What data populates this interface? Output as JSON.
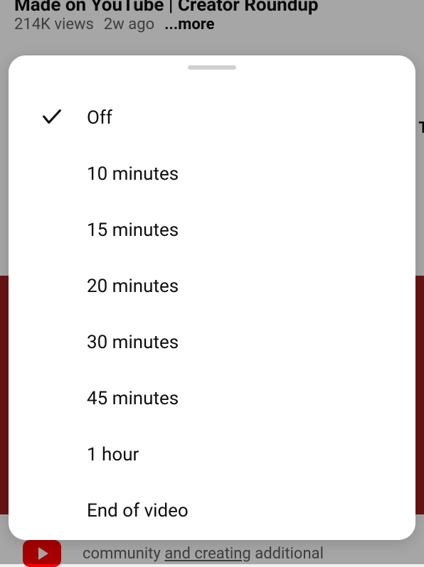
{
  "background": {
    "video_title": "Made on YouTube | Creator Roundup",
    "views": "214K views",
    "age": "2w ago",
    "more_label": "...more",
    "side_text": "T",
    "bottom_text_prefix": "community ",
    "bottom_text_underlined": "and creating",
    "bottom_text_suffix": " additional"
  },
  "sheet": {
    "options": [
      {
        "label": "Off",
        "selected": true
      },
      {
        "label": "10 minutes",
        "selected": false
      },
      {
        "label": "15 minutes",
        "selected": false
      },
      {
        "label": "20 minutes",
        "selected": false
      },
      {
        "label": "30 minutes",
        "selected": false
      },
      {
        "label": "45 minutes",
        "selected": false
      },
      {
        "label": "1 hour",
        "selected": false
      },
      {
        "label": "End of video",
        "selected": false
      }
    ]
  }
}
